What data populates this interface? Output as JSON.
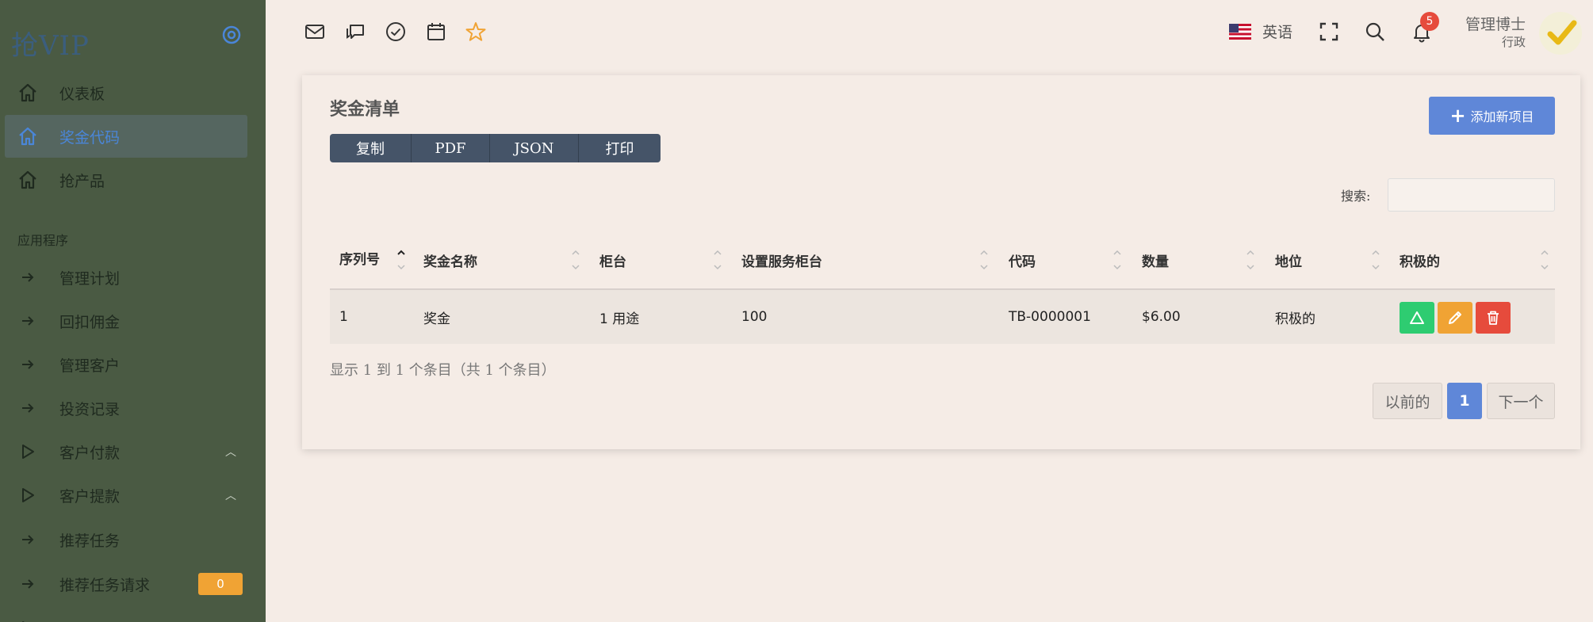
{
  "brand": {
    "name": "抢VIP"
  },
  "sidebar": {
    "items": [
      {
        "label": "仪表板",
        "icon": "home-icon"
      },
      {
        "label": "奖金代码",
        "icon": "home-icon",
        "active": true
      },
      {
        "label": "抢产品",
        "icon": "home-icon"
      }
    ],
    "section_title": "应用程序",
    "app_items": [
      {
        "label": "管理计划",
        "icon": "arrow-right-icon"
      },
      {
        "label": "回扣佣金",
        "icon": "arrow-right-icon"
      },
      {
        "label": "管理客户",
        "icon": "arrow-right-icon"
      },
      {
        "label": "投资记录",
        "icon": "arrow-right-icon"
      },
      {
        "label": "客户付款",
        "icon": "play-icon"
      },
      {
        "label": "客户提款",
        "icon": "play-icon"
      },
      {
        "label": "推荐任务",
        "icon": "arrow-right-icon"
      },
      {
        "label": "推荐任务请求",
        "icon": "arrow-right-icon",
        "badge": "0"
      }
    ]
  },
  "topbar": {
    "language": "英语",
    "notification_count": "5",
    "user_name": "管理博士",
    "user_role": "行政"
  },
  "card": {
    "title": "奖金清单",
    "export_buttons": [
      "复制",
      "PDF",
      "JSON",
      "打印"
    ],
    "add_button": "添加新项目",
    "search_label": "搜索:",
    "search_value": ""
  },
  "table": {
    "headers": [
      "序列号",
      "奖金名称",
      "柜台",
      "设置服务柜台",
      "代码",
      "数量",
      "地位",
      "积极的"
    ],
    "rows": [
      [
        "1",
        "奖金",
        "1 用途",
        "100",
        "TB-0000001",
        "$6.00",
        "积极的"
      ]
    ]
  },
  "footer": {
    "info": "显示 1 到 1 个条目（共 1 个条目）",
    "prev": "以前的",
    "page": "1",
    "next": "下一个"
  },
  "colors": {
    "sidebar_bg": "#4a5a43",
    "primary": "#5f87d8",
    "success": "#2ecc71",
    "warning": "#f0a334",
    "danger": "#e64b3c",
    "button_dark": "#455468"
  }
}
